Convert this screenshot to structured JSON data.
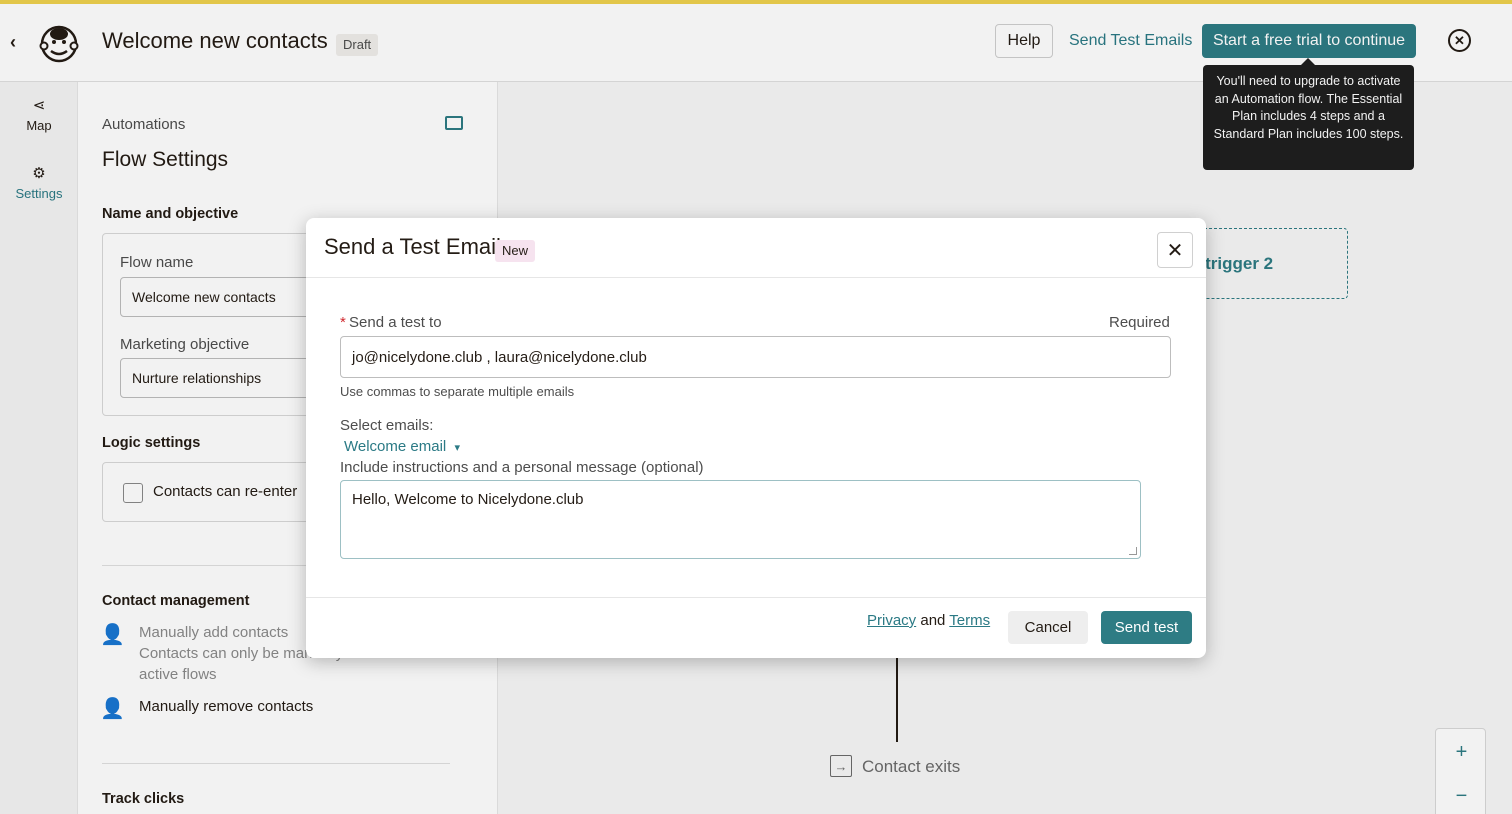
{
  "header": {
    "back_icon": "chevron-left-icon",
    "logo": "mailchimp-freddie-logo",
    "title": "Welcome new contacts",
    "status_badge": "Draft",
    "help_label": "Help",
    "send_test_emails_label": "Send Test Emails",
    "trial_label": "Start a free trial to continue",
    "close_icon": "close-circle-icon",
    "tooltip": "You'll need to upgrade to activate an Automation flow. The Essential Plan includes 4 steps and a Standard Plan includes 100 steps."
  },
  "rail": {
    "items": [
      {
        "label": "Map",
        "icon": "map-branch-icon"
      },
      {
        "label": "Settings",
        "icon": "gear-icon"
      }
    ]
  },
  "settings_panel": {
    "breadcrumb": "Automations",
    "title": "Flow Settings",
    "name_objective": {
      "heading": "Name and objective",
      "flow_name_label": "Flow name",
      "flow_name_value": "Welcome new contacts",
      "objective_label": "Marketing objective",
      "objective_value": "Nurture relationships"
    },
    "logic": {
      "heading": "Logic settings",
      "reenter_label": "Contacts can re-enter"
    },
    "contact_management": {
      "heading": "Contact management",
      "add_title": "Manually add contacts",
      "add_desc": "Contacts can only be manually added to active flows",
      "remove_title": "Manually remove contacts"
    },
    "track_clicks_heading": "Track clicks"
  },
  "canvas": {
    "trigger_label": "d trigger 2",
    "exit_label": "Contact exits",
    "zoom_in": "+",
    "zoom_out": "−"
  },
  "modal": {
    "title": "Send a Test Email",
    "badge": "New",
    "close_icon": "close-icon",
    "send_to_label": "Send a test to",
    "required_star": "*",
    "required_text": "Required",
    "emails_value": "jo@nicelydone.club , laura@nicelydone.club",
    "helper_text": "Use commas to separate multiple emails",
    "select_label": "Select emails:",
    "selected_email": "Welcome email",
    "instructions_label": "Include instructions and a personal message (optional)",
    "message_value": "Hello, Welcome to Nicelydone.club",
    "privacy_label": "Privacy",
    "and_text": "and",
    "terms_label": "Terms",
    "cancel_label": "Cancel",
    "send_label": "Send test"
  },
  "colors": {
    "accent": "#2e7c84",
    "link": "#2b7a85",
    "top_stripe": "#e2c64a",
    "required": "#d0282e"
  }
}
